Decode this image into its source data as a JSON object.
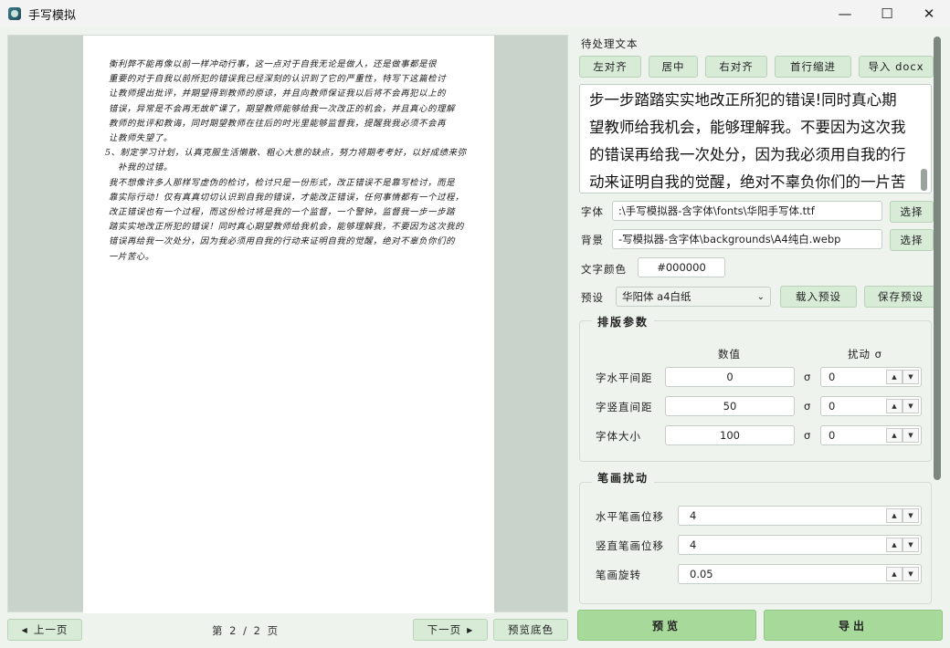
{
  "window": {
    "title": "手写模拟",
    "minimize": "—",
    "maximize": "☐",
    "close": "✕"
  },
  "paper_lines": [
    "衡利弊不能再像以前一样冲动行事，这一点对于自我无论是做人，还是做事都是很",
    "重要的对于自我以前所犯的错误我已经深刻的认识到了它的严重性，特写下这篇检讨",
    "让教师提出批评，并期望得到教师的原谅，并且向教师保证我以后将不会再犯以上的",
    "错误，异常是不会再无故旷课了，期望教师能够给我一次改正的机会，并且真心的理解",
    "教师的批评和教诲，同时期望教师在往后的时光里能够监督我，提醒我我必须不会再",
    "让教师失望了。",
    "5、制定学习计划，认真克服生活懒散、粗心大意的缺点，努力将期考考好，以好成绩来弥",
    "补我的过错。",
    "我不想像许多人那样写虚伪的检讨，检讨只是一份形式，改正错误不是靠写检讨，而是",
    "靠实际行动！仅有真真切切认识到自我的错误，才能改正错误，任何事情都有一个过程，",
    "改正错误也有一个过程，而这份检讨将是我的一个监督，一个警钟，监督我一步一步踏",
    "踏实实地改正所犯的错误！同时真心期望教师给我机会，能够理解我，不要因为这次我的",
    "错误再给我一次处分，因为我必须用自我的行动来证明自我的觉醒，绝对不辜负你们的",
    "一片苦心。"
  ],
  "nav": {
    "prev": "上一页",
    "page": "第 2 / 2 页",
    "next": "下一页",
    "bg_color": "预览底色"
  },
  "text_section": {
    "label": "待处理文本",
    "buttons": [
      "左对齐",
      "居中",
      "右对齐",
      "首行缩进",
      "导入 docx"
    ],
    "content": "步一步踏踏实实地改正所犯的错误!同时真心期望教师给我机会，能够理解我。不要因为这次我的错误再给我一次处分，因为我必须用自我的行动来证明自我的觉醒，绝对不辜负你们的一片苦心。"
  },
  "font": {
    "label": "字体",
    "value": ":\\手写模拟器-含字体\\fonts\\华阳手写体.ttf",
    "button": "选择"
  },
  "background": {
    "label": "背景",
    "value": "-写模拟器-含字体\\backgrounds\\A4纯白.webp",
    "button": "选择"
  },
  "text_color": {
    "label": "文字颜色",
    "value": "#000000"
  },
  "preset": {
    "label": "预设",
    "selected": "华阳体 a4白纸",
    "load": "载入预设",
    "save": "保存预设"
  },
  "layout_params": {
    "title": "排版参数",
    "col_value": "数值",
    "col_jitter": "扰动 σ",
    "sigma": "σ",
    "rows": [
      {
        "label": "字水平间距",
        "value": "0",
        "jitter": "0"
      },
      {
        "label": "字竖直间距",
        "value": "50",
        "jitter": "0"
      },
      {
        "label": "字体大小",
        "value": "100",
        "jitter": "0"
      }
    ]
  },
  "stroke_params": {
    "title": "笔画扰动",
    "rows": [
      {
        "label": "水平笔画位移",
        "value": "4"
      },
      {
        "label": "竖直笔画位移",
        "value": "4"
      },
      {
        "label": "笔画旋转",
        "value": "0.05"
      }
    ]
  },
  "actions": {
    "preview": "预览",
    "export": "导出"
  }
}
